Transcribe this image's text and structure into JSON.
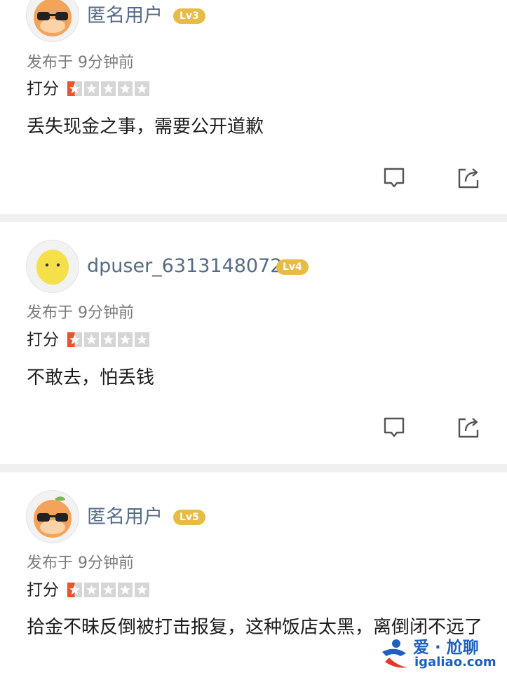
{
  "reviews": [
    {
      "username": "匿名用户",
      "level": "Lv3",
      "avatar": "orange-sunglasses-avatar",
      "posted": "发布于 9分钟前",
      "rating_label": "打分",
      "rating": 0.5,
      "comment": "丢失现金之事，需要公开道歉"
    },
    {
      "username": "dpuser_6313148072",
      "level": "Lv4",
      "avatar": "lemon-avatar",
      "posted": "发布于 9分钟前",
      "rating_label": "打分",
      "rating": 0.5,
      "comment": "不敢去，怕丢钱"
    },
    {
      "username": "匿名用户",
      "level": "Lv5",
      "avatar": "orange-sunglasses-avatar",
      "posted": "发布于 9分钟前",
      "rating_label": "打分",
      "rating": 0.5,
      "comment": "拾金不昧反倒被打击报复，这种饭店太黑，离倒闭不远了"
    }
  ],
  "icons": {
    "comment": "comment-bubble-icon",
    "share": "share-icon"
  },
  "watermark": {
    "top": "爱 · 尬聊",
    "bottom": "igaliao.com"
  },
  "colors": {
    "username": "#556b85",
    "level_badge": "#e8bb45",
    "star_filled": "#e8542c",
    "star_empty": "#d6d6d6",
    "watermark": "#1f5fbf"
  }
}
